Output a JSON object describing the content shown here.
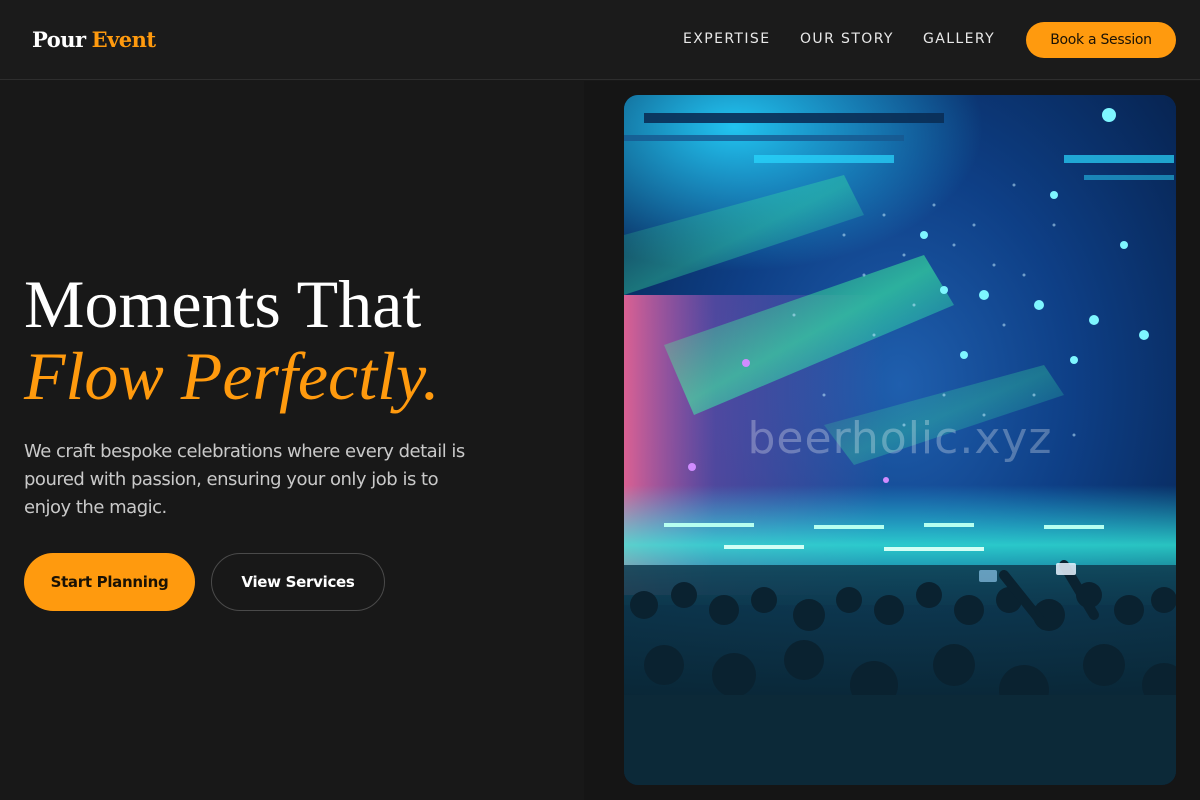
{
  "header": {
    "logo_part1": "Pour",
    "logo_part2": "Event",
    "nav": {
      "expertise": "EXPERTISE",
      "our_story": "OUR STORY",
      "gallery": "GALLERY"
    },
    "cta_label": "Book a Session"
  },
  "hero": {
    "title_line1": "Moments That",
    "title_line2": "Flow Perfectly.",
    "description": "We craft bespoke celebrations where every detail is poured with passion, ensuring your only job is to enjoy the magic.",
    "primary_button": "Start Planning",
    "secondary_button": "View Services"
  },
  "image": {
    "watermark": "beerholic.xyz",
    "subject": "concert-crowd-photo"
  },
  "colors": {
    "accent": "#ff9a0e",
    "background": "#181818"
  }
}
